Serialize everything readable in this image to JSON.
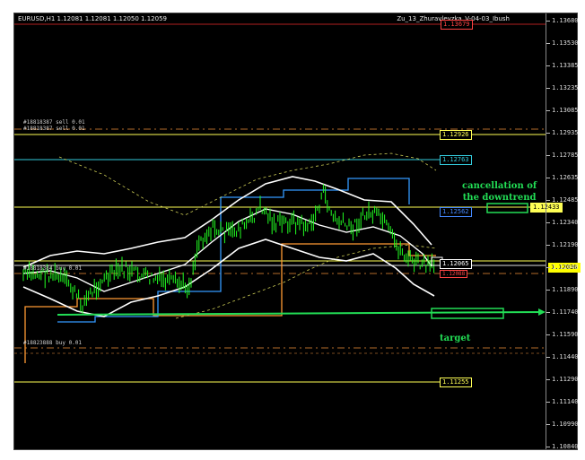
{
  "chart": {
    "symbol_header": "EURUSD,H1  1.12081 1.12081 1.12050 1.12059",
    "indicator_name": "Zu_13_Zhuravlevzka_V-04-03_Ibush",
    "top_level_tag": "1.13679"
  },
  "price_axis": {
    "labels": [
      "1.13680",
      "1.13530",
      "1.13385",
      "1.13235",
      "1.13085",
      "1.12935",
      "1.12785",
      "1.12635",
      "1.12485",
      "1.12340",
      "1.12190",
      "1.12040",
      "1.11890",
      "1.11740",
      "1.11590",
      "1.11440",
      "1.11290",
      "1.11140",
      "1.10990",
      "1.10840"
    ],
    "current_price_tag": "1.12036",
    "colors": {
      "current_price_bg": "#ffff00",
      "stop_tag": "#ff2b2b"
    }
  },
  "order_labels": {
    "sell_line_1": "#18818387 sell 0.01",
    "sell_line_2": "#18818387 sell 0.01",
    "buy_line_1": "#18818384 buy 0.01",
    "buy_line_2": "#18823888 buy 0.01"
  },
  "level_tags": {
    "yellow_top": "1.12926",
    "cyan_upper": "1.12763",
    "blue_mid": "1.12562",
    "yellow_right": "1.12433",
    "white_current": "1.12065",
    "red_small": "1.12088",
    "yellow_bottom": "1.11255"
  },
  "annotations": {
    "cancellation_line1": "cancellation of",
    "cancellation_line2": "the downtrend",
    "target": "target"
  },
  "colors": {
    "background": "#000000",
    "candles": "#22ff22",
    "bands": "#ffffff",
    "yellow_levels": "#ffff55",
    "cyan_levels": "#33ccdd",
    "orange_lines": "#ff9933",
    "annotation_green": "#22dd55"
  }
}
